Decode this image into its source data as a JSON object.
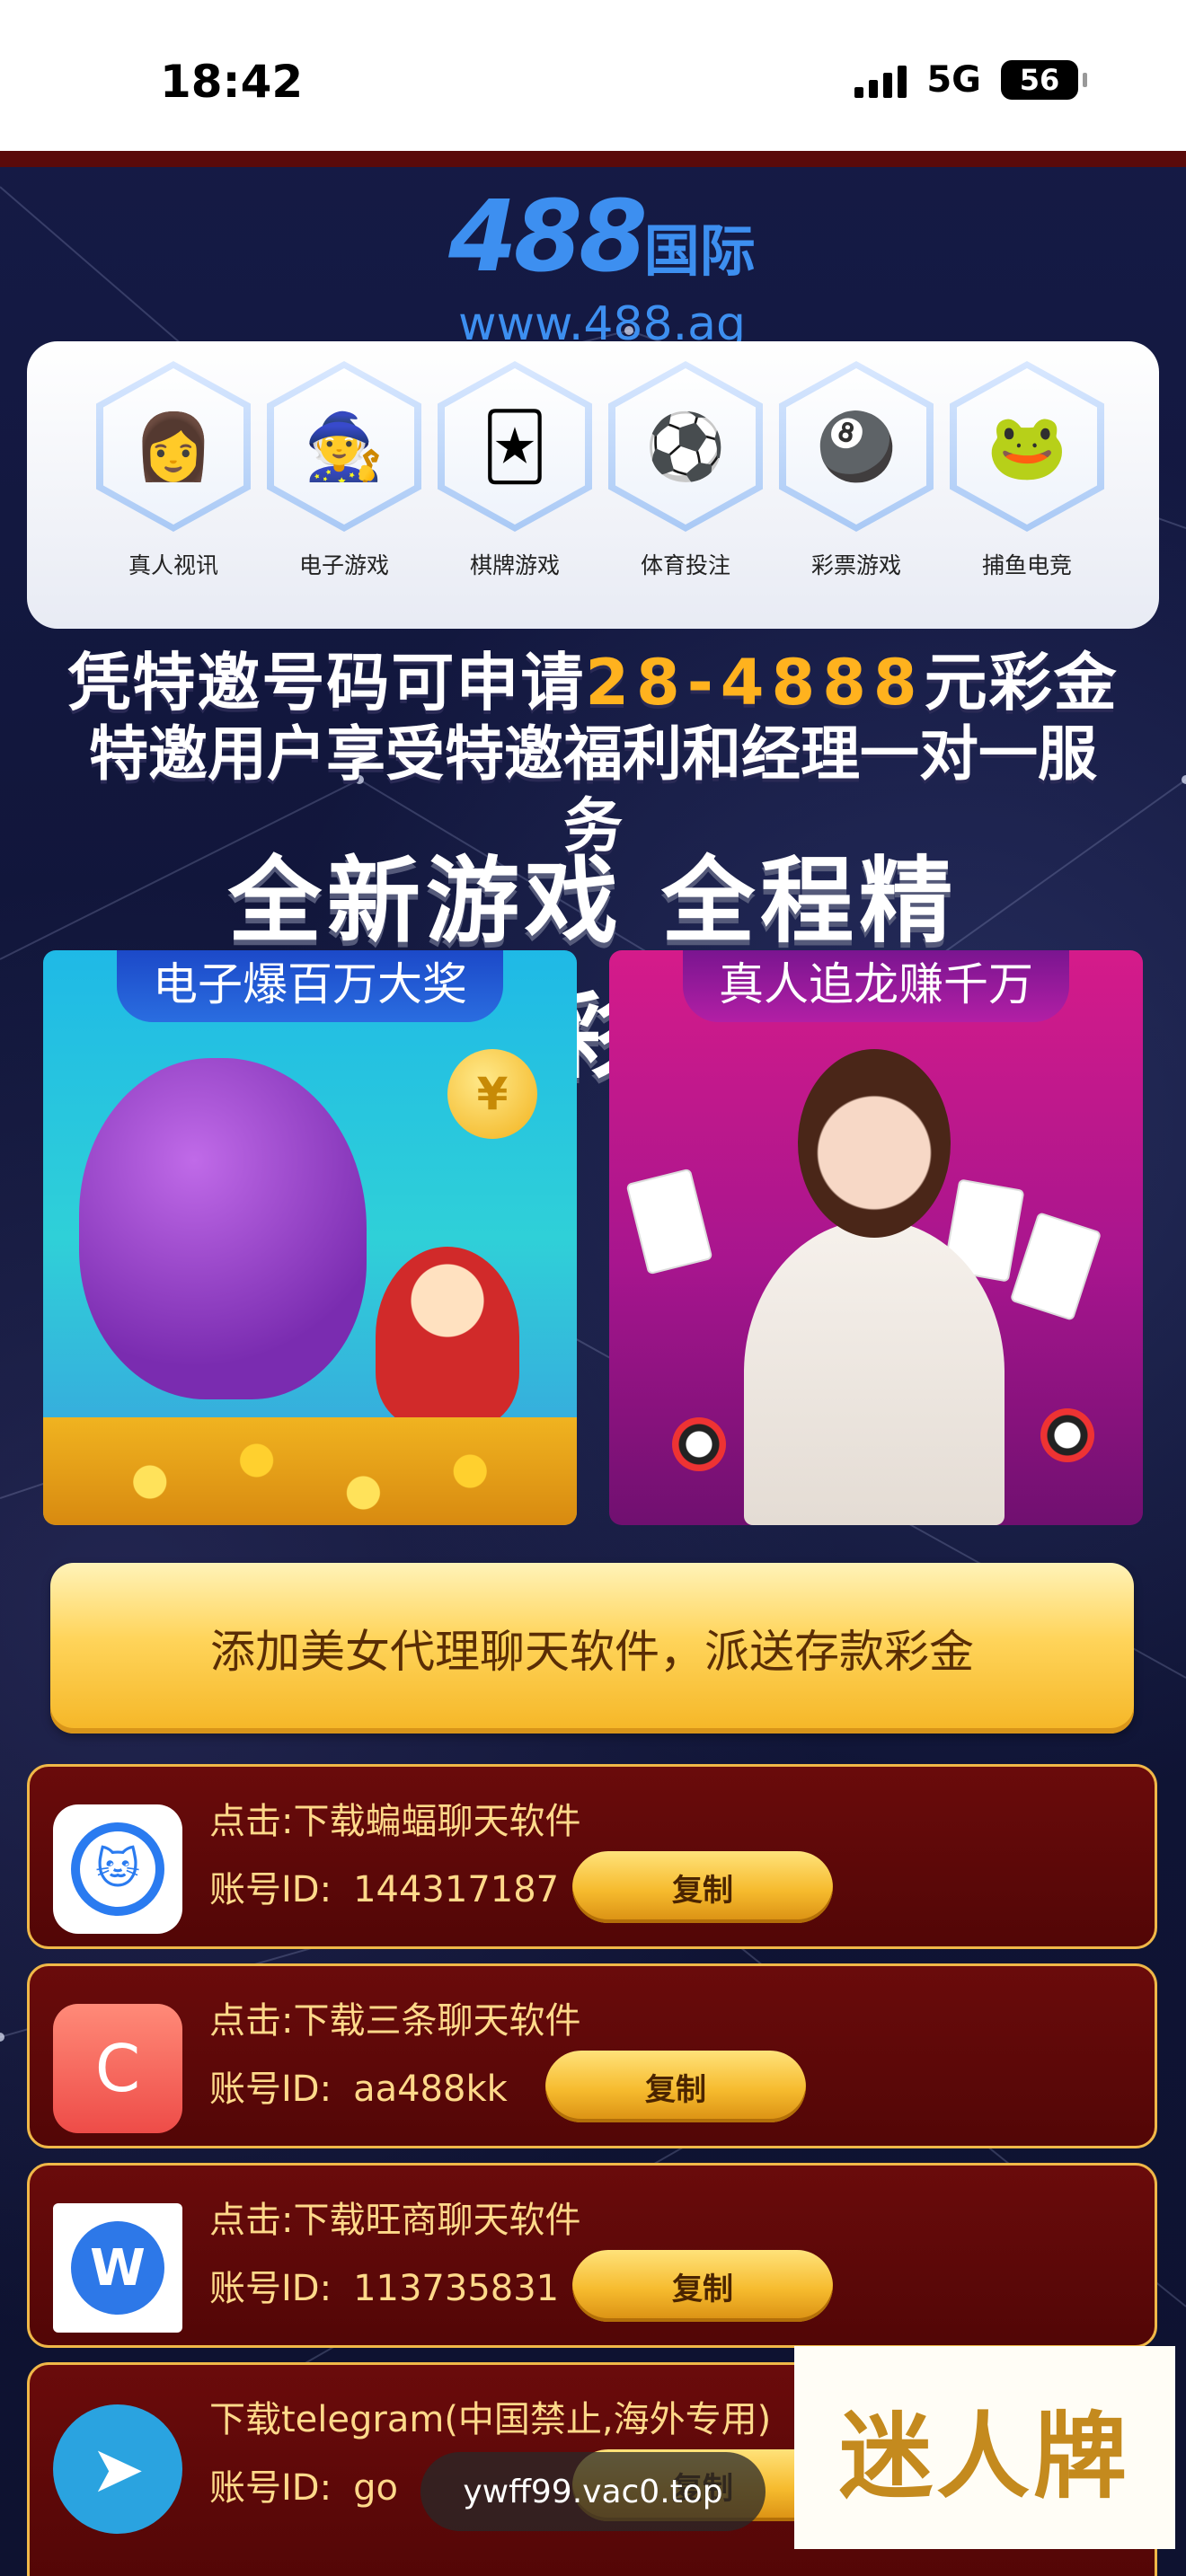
{
  "status_bar": {
    "time": "18:42",
    "network": "5G",
    "battery": "56"
  },
  "logo": {
    "number": "488",
    "name_cn": "国际",
    "url": "www.488.ag"
  },
  "categories": [
    {
      "label": "真人视讯",
      "icon": "live-casino-icon",
      "glyph": "👩"
    },
    {
      "label": "电子游戏",
      "icon": "slot-game-icon",
      "glyph": "🧙"
    },
    {
      "label": "棋牌游戏",
      "icon": "card-game-icon",
      "glyph": "🃏"
    },
    {
      "label": "体育投注",
      "icon": "sports-icon",
      "glyph": "⚽"
    },
    {
      "label": "彩票游戏",
      "icon": "lottery-icon",
      "glyph": "🎱"
    },
    {
      "label": "捕鱼电竞",
      "icon": "fishing-icon",
      "glyph": "🐸"
    }
  ],
  "promo": {
    "line1_pre": "凭特邀号码可申请",
    "line1_amount": "28-4888",
    "line1_post": "元彩金",
    "line2": "特邀用户享受特邀福利和经理一对一服务",
    "headline": "全新游戏 全程精彩"
  },
  "banners": {
    "left_title": "电子爆百万大奖",
    "right_title": "真人追龙赚千万",
    "coin_symbol": "¥"
  },
  "cta": {
    "label": "添加美女代理聊天软件，派送存款彩金"
  },
  "accounts": [
    {
      "title": "点击:下载蝙蝠聊天软件",
      "id_label": "账号ID:",
      "id": "144317187",
      "copy": "复制",
      "icon": "bat-chat-icon",
      "glyph": "🐱",
      "bg": "#2a7bf0"
    },
    {
      "title": "点击:下载三条聊天软件",
      "id_label": "账号ID:",
      "id": "aa488kk",
      "copy": "复制",
      "icon": "santiao-chat-icon",
      "glyph": "C",
      "bg": "#f2645a"
    },
    {
      "title": "点击:下载旺商聊天软件",
      "id_label": "账号ID:",
      "id": "113735831",
      "copy": "复制",
      "icon": "wangshang-chat-icon",
      "glyph": "W",
      "bg": "#ffffff"
    },
    {
      "title": "下载telegram(中国禁止,海外专用)",
      "id_label": "账号ID:",
      "id": "go",
      "copy": "复制",
      "icon": "telegram-icon",
      "glyph": "➤",
      "bg": "#2aa3e0"
    }
  ],
  "watermark": {
    "text": "迷人牌"
  },
  "url_pill": {
    "text": "ywff99.vac0.top"
  }
}
